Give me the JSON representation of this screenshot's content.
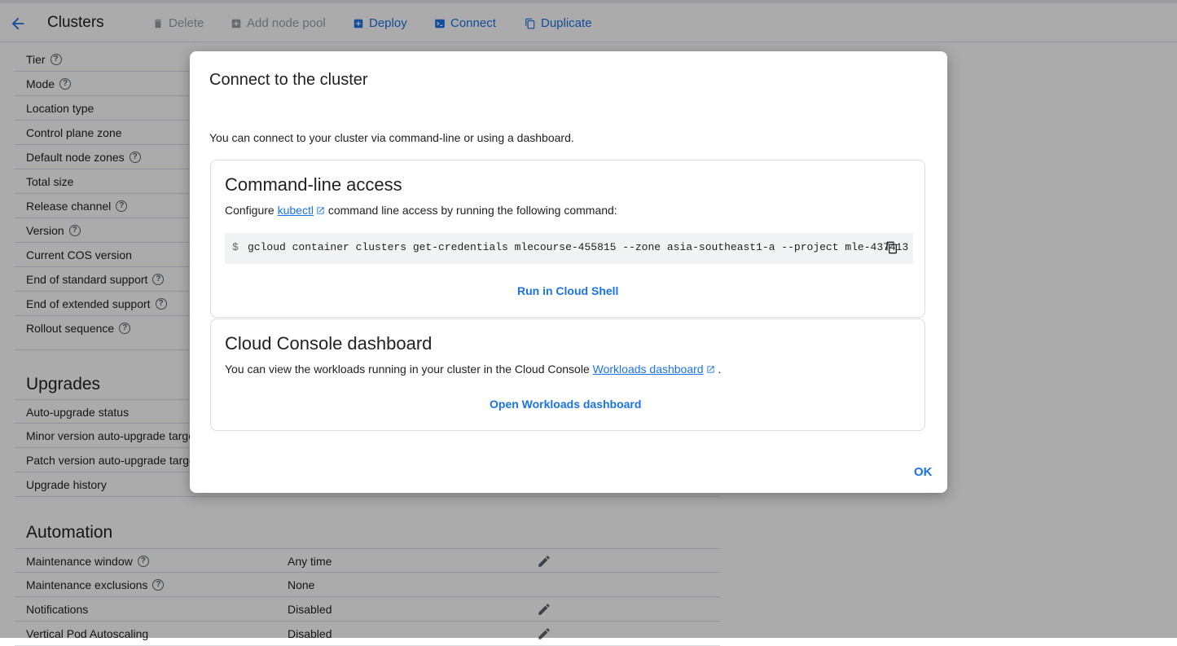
{
  "toolbar": {
    "title": "Clusters",
    "delete": "Delete",
    "add_node_pool": "Add node pool",
    "deploy": "Deploy",
    "connect": "Connect",
    "duplicate": "Duplicate"
  },
  "details": {
    "rows": [
      {
        "label": "Tier",
        "help": true
      },
      {
        "label": "Mode",
        "help": true
      },
      {
        "label": "Location type",
        "help": false
      },
      {
        "label": "Control plane zone",
        "help": false
      },
      {
        "label": "Default node zones",
        "help": true
      },
      {
        "label": "Total size",
        "help": false
      },
      {
        "label": "Release channel",
        "help": true
      },
      {
        "label": "Version",
        "help": true
      },
      {
        "label": "Current COS version",
        "help": false
      },
      {
        "label": "End of standard support",
        "help": true
      },
      {
        "label": "End of extended support",
        "help": true
      },
      {
        "label": "Rollout sequence",
        "help": true
      }
    ]
  },
  "upgrades": {
    "heading": "Upgrades",
    "rows": [
      {
        "label": "Auto-upgrade status"
      },
      {
        "label": "Minor version auto-upgrade targe"
      },
      {
        "label": "Patch version auto-upgrade targe"
      },
      {
        "label": "Upgrade history"
      }
    ]
  },
  "automation": {
    "heading": "Automation",
    "rows": [
      {
        "label": "Maintenance window",
        "value": "Any time"
      },
      {
        "label": "Maintenance exclusions",
        "value": "None"
      },
      {
        "label": "Notifications",
        "value": "Disabled"
      },
      {
        "label": "Vertical Pod Autoscaling",
        "value": "Disabled"
      }
    ]
  },
  "dialog": {
    "title": "Connect to the cluster",
    "intro": "You can connect to your cluster via command-line or using a dashboard.",
    "cli": {
      "heading": "Command-line access",
      "text_before": "Configure ",
      "link": "kubectl",
      "text_after": " command line access by running the following command:",
      "prompt": "$",
      "command": "gcloud container clusters get-credentials mlecourse-455815 --zone asia-southeast1-a --project mle-437413",
      "run_button": "Run in Cloud Shell"
    },
    "dashboard": {
      "heading": "Cloud Console dashboard",
      "text_before": "You can view the workloads running in your cluster in the Cloud Console ",
      "link": "Workloads dashboard",
      "text_after": " .",
      "open_button": "Open Workloads dashboard"
    },
    "ok": "OK"
  },
  "colors": {
    "accent": "#1a73e8",
    "disabled": "#9aa0a6",
    "scrim": "rgba(0,0,0,0.33)"
  }
}
